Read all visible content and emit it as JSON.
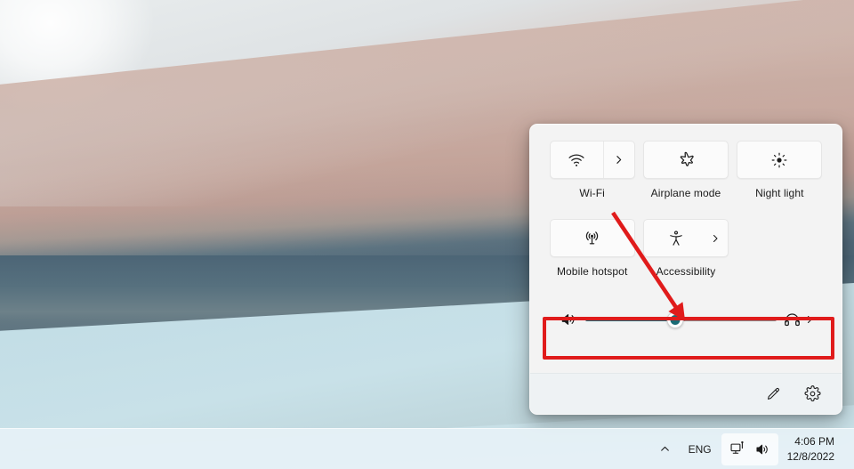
{
  "desktop": {
    "wallpaper_name": "windows-11-sand-dune-wallpaper",
    "colors": {
      "sky": "#e3e7e9",
      "dune": "#cbb0a7",
      "water_dark": "#4e6675",
      "water_light": "#c6dfe7",
      "taskbar": "#e6f1f6"
    }
  },
  "quick_settings": {
    "panel_name": "quick-settings-flyout",
    "tiles": [
      {
        "id": "wifi",
        "label": "Wi-Fi",
        "icon": "wifi-icon",
        "has_chevron": true,
        "chevron_style": "split",
        "chevron_icon": "chevron-right-icon"
      },
      {
        "id": "airplane-mode",
        "label": "Airplane mode",
        "icon": "airplane-icon",
        "has_chevron": false,
        "chevron_style": "none",
        "chevron_icon": ""
      },
      {
        "id": "night-light",
        "label": "Night light",
        "icon": "brightness-sun-icon",
        "has_chevron": false,
        "chevron_style": "none",
        "chevron_icon": ""
      },
      {
        "id": "mobile-hotspot",
        "label": "Mobile hotspot",
        "icon": "hotspot-broadcast-icon",
        "has_chevron": false,
        "chevron_style": "none",
        "chevron_icon": ""
      },
      {
        "id": "accessibility",
        "label": "Accessibility",
        "icon": "accessibility-person-icon",
        "has_chevron": true,
        "chevron_style": "inline",
        "chevron_icon": "chevron-right-icon"
      }
    ],
    "volume": {
      "row_name": "volume-slider-row",
      "speaker_icon": "speaker-volume-icon",
      "output_icon": "headphones-icon",
      "output_chevron_icon": "chevron-right-icon",
      "level_percent": 47,
      "fill_color": "#1a6b75",
      "rail_color": "#868686"
    },
    "footer": {
      "edit_icon": "pencil-edit-icon",
      "settings_icon": "gear-settings-icon"
    }
  },
  "annotation": {
    "color": "#e01b1b",
    "highlight_name": "volume-row-highlight-box",
    "arrow_name": "pointer-arrow",
    "arrow_from": "688,238",
    "arrow_to": "768,357"
  },
  "taskbar": {
    "hidden_icons_button": "show-hidden-icons-chevron-up-icon",
    "language": "ENG",
    "network_icon": "network-display-icon",
    "volume_icon": "speaker-volume-icon",
    "time": "4:06 PM",
    "date": "12/8/2022"
  }
}
